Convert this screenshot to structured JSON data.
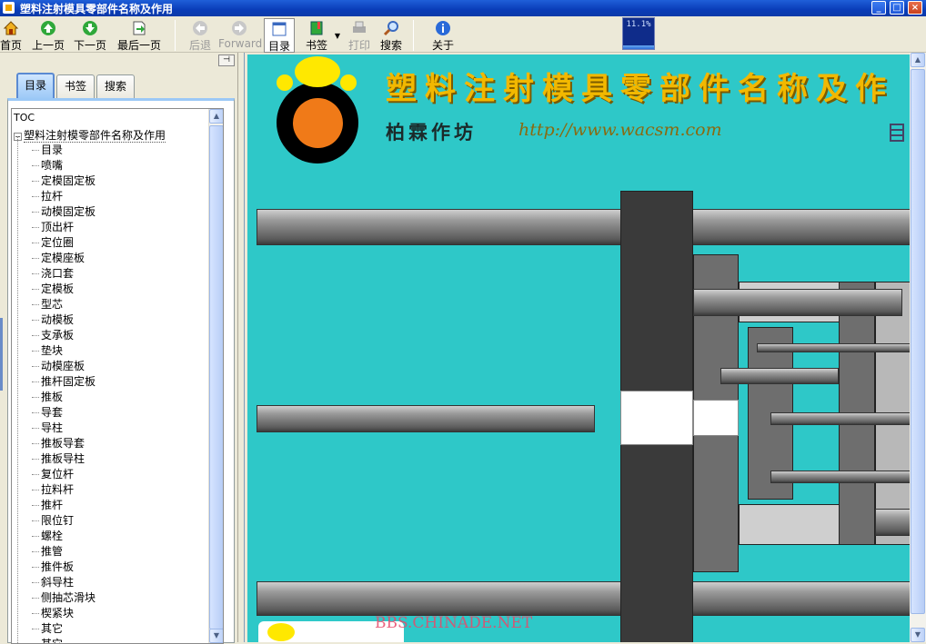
{
  "window": {
    "title": "塑料注射模具零部件名称及作用"
  },
  "toolbar": {
    "home": "首页",
    "prev": "上一页",
    "next": "下一页",
    "last": "最后一页",
    "back": "后退",
    "forward": "Forward",
    "toc": "目录",
    "bookmark": "书签",
    "print": "打印",
    "search": "搜索",
    "about": "关于",
    "progress_text": "11.1%",
    "progress_value": 0.111
  },
  "sidebar": {
    "tabs": [
      "目录",
      "书签",
      "搜索"
    ],
    "toc_label": "TOC",
    "root": "塑料注射模零部件名称及作用",
    "items": [
      "目录",
      "喷嘴",
      "定模固定板",
      "拉杆",
      "动模固定板",
      "顶出杆",
      "定位圈",
      "定模座板",
      "浇口套",
      "定模板",
      "型芯",
      "动模板",
      "支承板",
      " 垫块",
      "动模座板",
      "推杆固定板",
      "推板",
      "导套",
      "导柱",
      "推板导套",
      "推板导柱",
      "复位杆",
      "拉料杆",
      "推杆",
      "限位钉",
      "螺栓",
      "推管",
      "推件板",
      "斜导柱",
      "侧抽芯滑块",
      "楔紧块",
      "其它",
      "其它"
    ]
  },
  "document": {
    "title": "塑料注射模具零部件名称及作",
    "author": "柏霖作坊",
    "url": "http://www.wacsm.com",
    "watermark": "BBS.CHINADE.NET",
    "colors": {
      "background": "#2ec8c8",
      "title": "#f2b800",
      "logo_core": "#f07a18",
      "logo_accent": "#ffe800"
    }
  }
}
